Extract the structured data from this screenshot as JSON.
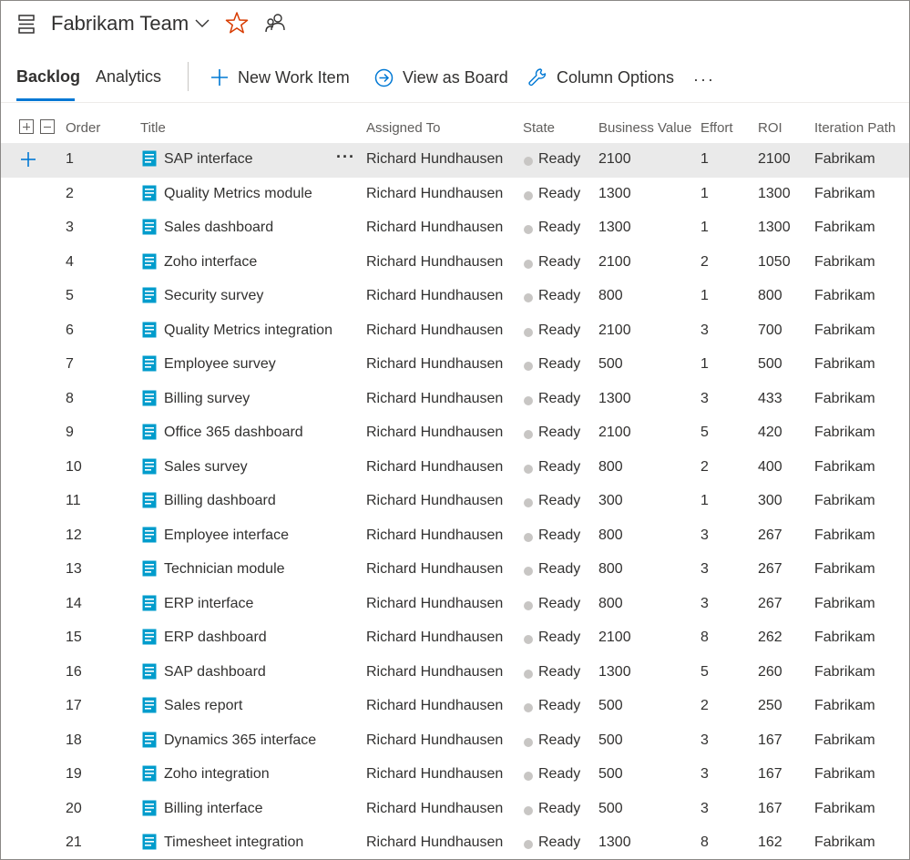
{
  "header": {
    "team_name": "Fabrikam Team",
    "icons": {
      "team": "backlog-icon",
      "dropdown": "chevron-down-icon",
      "favorite": "star-icon",
      "members": "team-members-icon"
    },
    "accent": "#0078d4",
    "star_color": "#d83b01"
  },
  "toolbar": {
    "tabs": [
      {
        "label": "Backlog"
      },
      {
        "label": "Analytics"
      }
    ],
    "new_work_item": "New Work Item",
    "view_as_board": "View as Board",
    "column_options": "Column Options",
    "more": "···"
  },
  "table": {
    "columns": {
      "order": "Order",
      "title": "Title",
      "assigned_to": "Assigned To",
      "state": "State",
      "business_value": "Business Value",
      "effort": "Effort",
      "roi": "ROI",
      "iteration_path": "Iteration Path"
    },
    "row_more": "···",
    "rows": [
      {
        "order": "1",
        "title": "SAP interface",
        "assigned_to": "Richard Hundhausen",
        "state": "Ready",
        "business_value": "2100",
        "effort": "1",
        "roi": "2100",
        "iteration": "Fabrikam"
      },
      {
        "order": "2",
        "title": "Quality Metrics module",
        "assigned_to": "Richard Hundhausen",
        "state": "Ready",
        "business_value": "1300",
        "effort": "1",
        "roi": "1300",
        "iteration": "Fabrikam"
      },
      {
        "order": "3",
        "title": "Sales dashboard",
        "assigned_to": "Richard Hundhausen",
        "state": "Ready",
        "business_value": "1300",
        "effort": "1",
        "roi": "1300",
        "iteration": "Fabrikam"
      },
      {
        "order": "4",
        "title": "Zoho interface",
        "assigned_to": "Richard Hundhausen",
        "state": "Ready",
        "business_value": "2100",
        "effort": "2",
        "roi": "1050",
        "iteration": "Fabrikam"
      },
      {
        "order": "5",
        "title": "Security survey",
        "assigned_to": "Richard Hundhausen",
        "state": "Ready",
        "business_value": "800",
        "effort": "1",
        "roi": "800",
        "iteration": "Fabrikam"
      },
      {
        "order": "6",
        "title": "Quality Metrics integration",
        "assigned_to": "Richard Hundhausen",
        "state": "Ready",
        "business_value": "2100",
        "effort": "3",
        "roi": "700",
        "iteration": "Fabrikam"
      },
      {
        "order": "7",
        "title": "Employee survey",
        "assigned_to": "Richard Hundhausen",
        "state": "Ready",
        "business_value": "500",
        "effort": "1",
        "roi": "500",
        "iteration": "Fabrikam"
      },
      {
        "order": "8",
        "title": "Billing survey",
        "assigned_to": "Richard Hundhausen",
        "state": "Ready",
        "business_value": "1300",
        "effort": "3",
        "roi": "433",
        "iteration": "Fabrikam"
      },
      {
        "order": "9",
        "title": "Office 365 dashboard",
        "assigned_to": "Richard Hundhausen",
        "state": "Ready",
        "business_value": "2100",
        "effort": "5",
        "roi": "420",
        "iteration": "Fabrikam"
      },
      {
        "order": "10",
        "title": "Sales survey",
        "assigned_to": "Richard Hundhausen",
        "state": "Ready",
        "business_value": "800",
        "effort": "2",
        "roi": "400",
        "iteration": "Fabrikam"
      },
      {
        "order": "11",
        "title": "Billing dashboard",
        "assigned_to": "Richard Hundhausen",
        "state": "Ready",
        "business_value": "300",
        "effort": "1",
        "roi": "300",
        "iteration": "Fabrikam"
      },
      {
        "order": "12",
        "title": "Employee interface",
        "assigned_to": "Richard Hundhausen",
        "state": "Ready",
        "business_value": "800",
        "effort": "3",
        "roi": "267",
        "iteration": "Fabrikam"
      },
      {
        "order": "13",
        "title": "Technician module",
        "assigned_to": "Richard Hundhausen",
        "state": "Ready",
        "business_value": "800",
        "effort": "3",
        "roi": "267",
        "iteration": "Fabrikam"
      },
      {
        "order": "14",
        "title": "ERP interface",
        "assigned_to": "Richard Hundhausen",
        "state": "Ready",
        "business_value": "800",
        "effort": "3",
        "roi": "267",
        "iteration": "Fabrikam"
      },
      {
        "order": "15",
        "title": "ERP dashboard",
        "assigned_to": "Richard Hundhausen",
        "state": "Ready",
        "business_value": "2100",
        "effort": "8",
        "roi": "262",
        "iteration": "Fabrikam"
      },
      {
        "order": "16",
        "title": "SAP dashboard",
        "assigned_to": "Richard Hundhausen",
        "state": "Ready",
        "business_value": "1300",
        "effort": "5",
        "roi": "260",
        "iteration": "Fabrikam"
      },
      {
        "order": "17",
        "title": "Sales report",
        "assigned_to": "Richard Hundhausen",
        "state": "Ready",
        "business_value": "500",
        "effort": "2",
        "roi": "250",
        "iteration": "Fabrikam"
      },
      {
        "order": "18",
        "title": "Dynamics 365 interface",
        "assigned_to": "Richard Hundhausen",
        "state": "Ready",
        "business_value": "500",
        "effort": "3",
        "roi": "167",
        "iteration": "Fabrikam"
      },
      {
        "order": "19",
        "title": "Zoho integration",
        "assigned_to": "Richard Hundhausen",
        "state": "Ready",
        "business_value": "500",
        "effort": "3",
        "roi": "167",
        "iteration": "Fabrikam"
      },
      {
        "order": "20",
        "title": "Billing interface",
        "assigned_to": "Richard Hundhausen",
        "state": "Ready",
        "business_value": "500",
        "effort": "3",
        "roi": "167",
        "iteration": "Fabrikam"
      },
      {
        "order": "21",
        "title": "Timesheet integration",
        "assigned_to": "Richard Hundhausen",
        "state": "Ready",
        "business_value": "1300",
        "effort": "8",
        "roi": "162",
        "iteration": "Fabrikam"
      }
    ]
  }
}
